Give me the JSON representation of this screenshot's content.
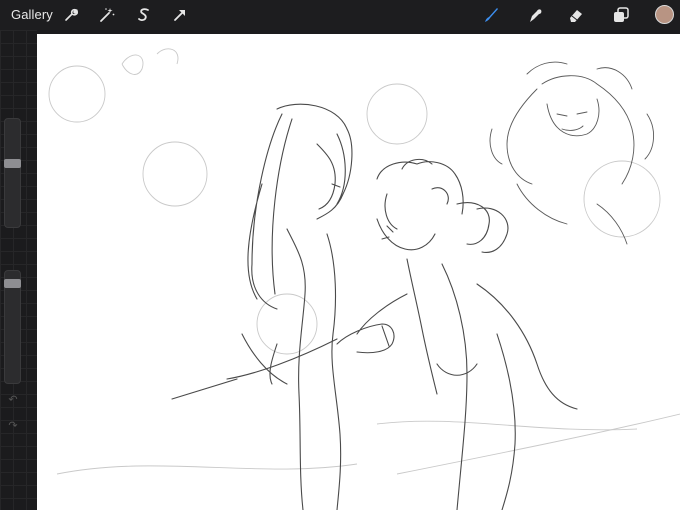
{
  "topbar": {
    "gallery_label": "Gallery",
    "actions_icon": "wrench-icon",
    "adjustments_icon": "magic-wand-icon",
    "selection_icon": "selection-s-icon",
    "transform_icon": "arrow-cursor-icon",
    "brush_icon": "brush-icon",
    "smudge_icon": "smudge-icon",
    "eraser_icon": "eraser-icon",
    "layers_icon": "layers-icon"
  },
  "colors": {
    "active_tool": "#3d8ff0",
    "current_color": "#b89483",
    "ui_dark": "#1d1d1f",
    "icon": "#e6e6e6"
  },
  "sidebar": {
    "brush_size_level": 0.45,
    "opacity_level": 0.0,
    "modify_icon": "square-icon",
    "undo_icon": "undo-arrow-icon",
    "redo_icon": "redo-arrow-icon"
  }
}
